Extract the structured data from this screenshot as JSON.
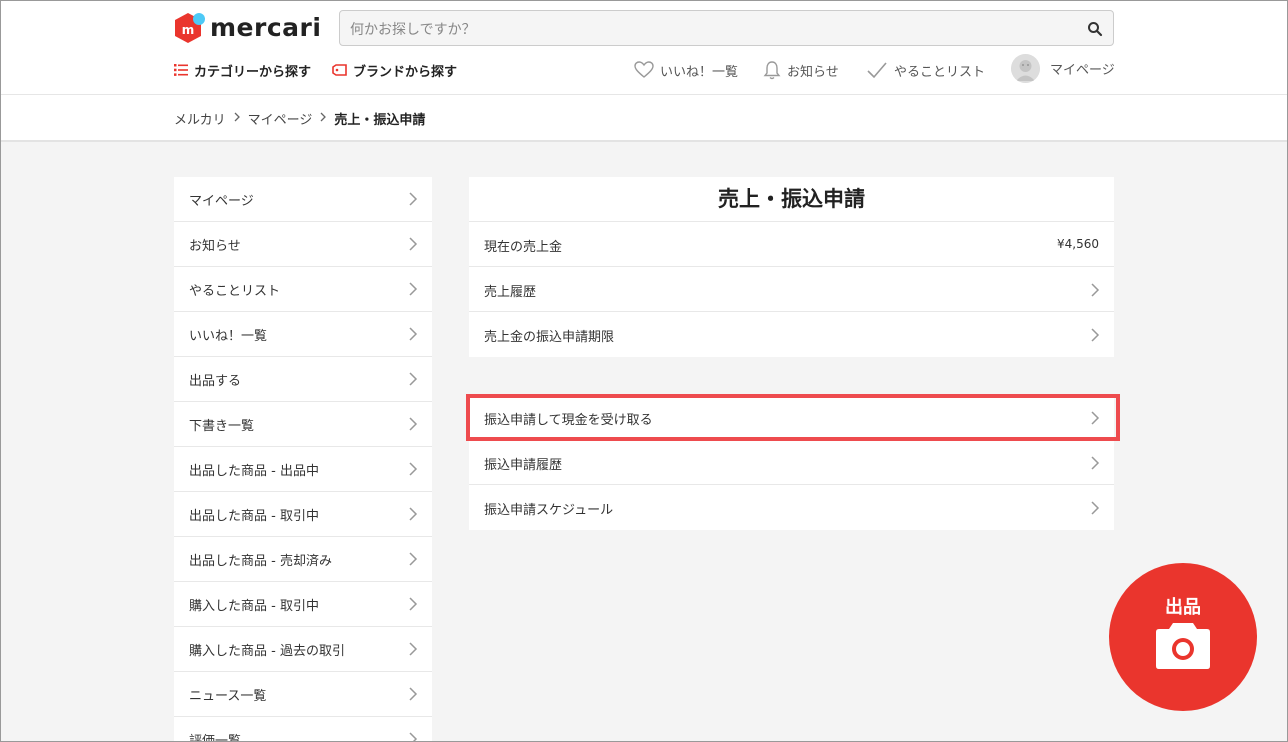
{
  "header": {
    "logo_text": "mercari",
    "search_placeholder": "何かお探しですか？",
    "category_link": "カテゴリーから探す",
    "brand_link": "ブランドから探す",
    "likes_link": "いいね！一覧",
    "notices_link": "お知らせ",
    "todo_link": "やることリスト",
    "mypage_link": "マイページ"
  },
  "breadcrumb": {
    "items": [
      "メルカリ",
      "マイページ",
      "売上・振込申請"
    ]
  },
  "sidebar": {
    "items": [
      {
        "label": "マイページ"
      },
      {
        "label": "お知らせ"
      },
      {
        "label": "やることリスト"
      },
      {
        "label": "いいね！一覧"
      },
      {
        "label": "出品する"
      },
      {
        "label": "下書き一覧"
      },
      {
        "label": "出品した商品 - 出品中"
      },
      {
        "label": "出品した商品 - 取引中"
      },
      {
        "label": "出品した商品 - 売却済み"
      },
      {
        "label": "購入した商品 - 取引中"
      },
      {
        "label": "購入した商品 - 過去の取引"
      },
      {
        "label": "ニュース一覧"
      },
      {
        "label": "評価一覧"
      }
    ]
  },
  "main": {
    "title": "売上・振込申請",
    "sales_section": [
      {
        "label": "現在の売上金",
        "value": "¥4,560"
      },
      {
        "label": "売上履歴"
      },
      {
        "label": "売上金の振込申請期限"
      }
    ],
    "transfer_section": [
      {
        "label": "振込申請して現金を受け取る"
      },
      {
        "label": "振込申請履歴"
      },
      {
        "label": "振込申請スケジュール"
      }
    ]
  },
  "fab": {
    "label": "出品"
  },
  "colors": {
    "brand_red": "#ea352d",
    "highlight_red": "#ee4b4e",
    "logo_blue": "#4dc9f6"
  }
}
